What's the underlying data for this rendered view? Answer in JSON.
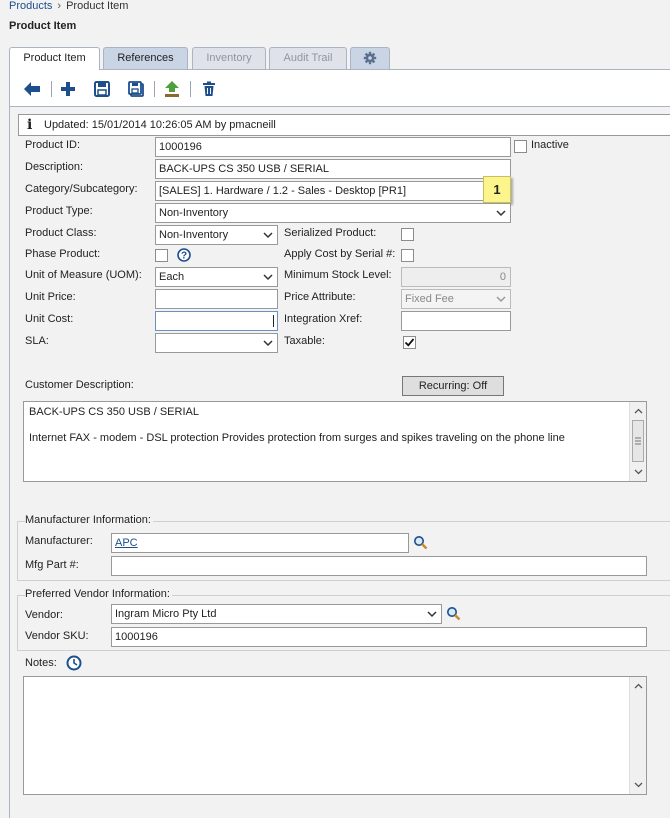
{
  "breadcrumb": {
    "root": "Products",
    "current": "Product Item"
  },
  "page_title": "Product Item",
  "tabs": [
    {
      "label": "Product Item",
      "state": "active"
    },
    {
      "label": "References",
      "state": "normal"
    },
    {
      "label": "Inventory",
      "state": "disabled"
    },
    {
      "label": "Audit Trail",
      "state": "disabled"
    }
  ],
  "toolbar": {
    "icons": [
      "back-arrow-icon",
      "add-icon",
      "save-icon",
      "save-as-icon",
      "upload-icon",
      "delete-icon"
    ]
  },
  "updated_text": "Updated:  15/01/2014  10:26:05 AM by pmacneill",
  "form": {
    "product_id": {
      "label": "Product ID:",
      "value": "1000196"
    },
    "inactive": {
      "label": "Inactive",
      "checked": false
    },
    "description": {
      "label": "Description:",
      "value": "BACK-UPS CS 350 USB / SERIAL"
    },
    "category": {
      "label": "Category/Subcategory:",
      "value": "[SALES] 1. Hardware / 1.2 - Sales - Desktop [PR1]"
    },
    "badge": "1",
    "product_type": {
      "label": "Product Type:",
      "value": "Non-Inventory"
    },
    "product_class": {
      "label": "Product Class:",
      "value": "Non-Inventory"
    },
    "serialized": {
      "label": "Serialized Product:",
      "checked": false
    },
    "phase_product": {
      "label": "Phase Product:",
      "checked": false
    },
    "apply_cost": {
      "label": "Apply Cost by Serial #:",
      "checked": false
    },
    "uom": {
      "label": "Unit of Measure (UOM):",
      "value": "Each"
    },
    "min_stock": {
      "label": "Minimum Stock Level:",
      "value": "0"
    },
    "unit_price": {
      "label": "Unit Price:",
      "value": ""
    },
    "price_attribute": {
      "label": "Price Attribute:",
      "value": "Fixed Fee"
    },
    "unit_cost": {
      "label": "Unit Cost:",
      "value": ""
    },
    "integration_xref": {
      "label": "Integration Xref:",
      "value": ""
    },
    "sla": {
      "label": "SLA:",
      "value": ""
    },
    "taxable": {
      "label": "Taxable:",
      "checked": true
    },
    "customer_description": {
      "label": "Customer Description:",
      "line1": "BACK-UPS CS 350 USB / SERIAL",
      "line2": "Internet FAX - modem - DSL protection Provides protection from surges and spikes traveling on the phone line"
    },
    "recurring_button": "Recurring: Off"
  },
  "manufacturer": {
    "legend": "Manufacturer Information:",
    "manufacturer_label": "Manufacturer:",
    "manufacturer_value": "APC",
    "mfg_part_label": "Mfg Part #:",
    "mfg_part_value": ""
  },
  "vendor": {
    "legend": "Preferred Vendor Information:",
    "vendor_label": "Vendor:",
    "vendor_value": "Ingram Micro Pty Ltd",
    "sku_label": "Vendor SKU:",
    "sku_value": "1000196"
  },
  "notes": {
    "label": "Notes:",
    "value": ""
  },
  "colors": {
    "accent": "#1c4f8c",
    "tab_bg": "#c9d5e5",
    "badge": "#fbf58c"
  }
}
